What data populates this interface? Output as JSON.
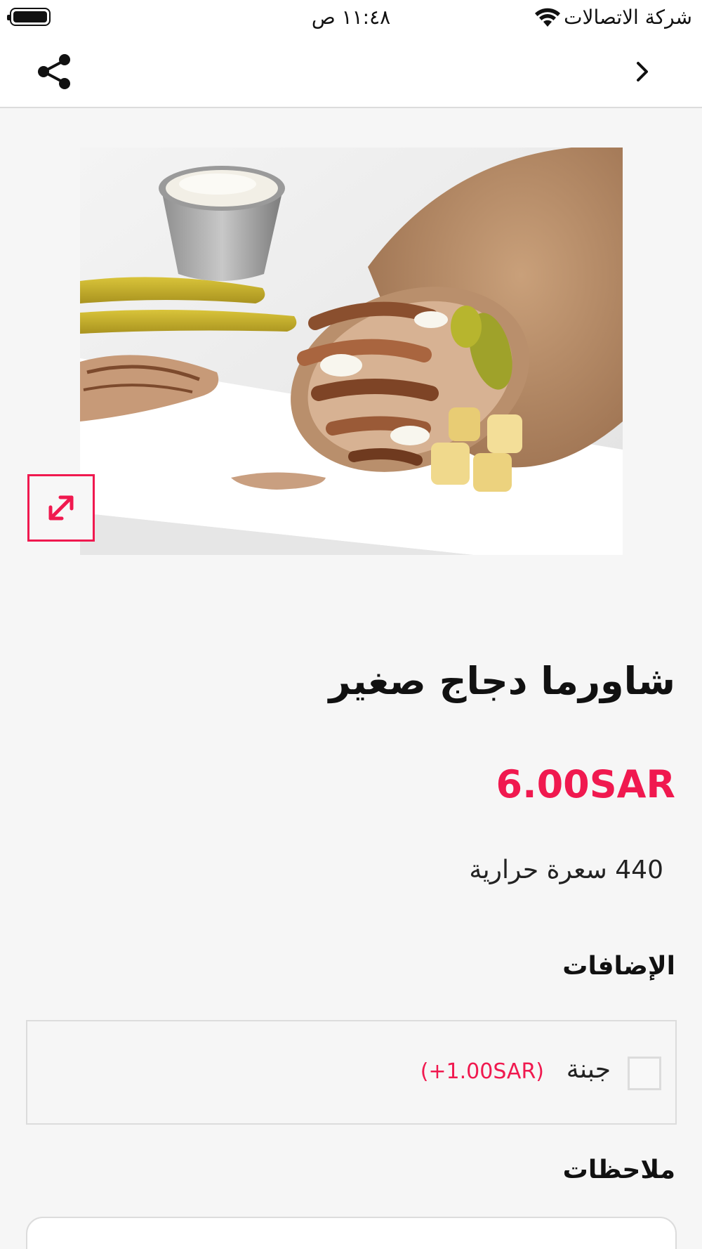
{
  "status_bar": {
    "carrier": "شركة الاتصالات",
    "time": "١١:٤٨ ص",
    "icons": [
      "battery-icon",
      "wifi-icon"
    ]
  },
  "nav": {
    "icons": [
      "share-icon",
      "chevron-right-icon"
    ]
  },
  "product": {
    "image_icon": "shawarma-photo",
    "expand_icon": "expand-icon",
    "title": "شاورما دجاج صغير",
    "price": "6.00SAR",
    "calories": "440 سعرة حرارية"
  },
  "addons": {
    "heading": "الإضافات",
    "items": [
      {
        "name": "جبنة",
        "price": "(+1.00SAR)",
        "checked": false
      }
    ]
  },
  "notes": {
    "heading": "ملاحظات",
    "value": ""
  },
  "colors": {
    "accent": "#f0194f",
    "background": "#f6f6f6",
    "border": "#dcdcdc"
  }
}
